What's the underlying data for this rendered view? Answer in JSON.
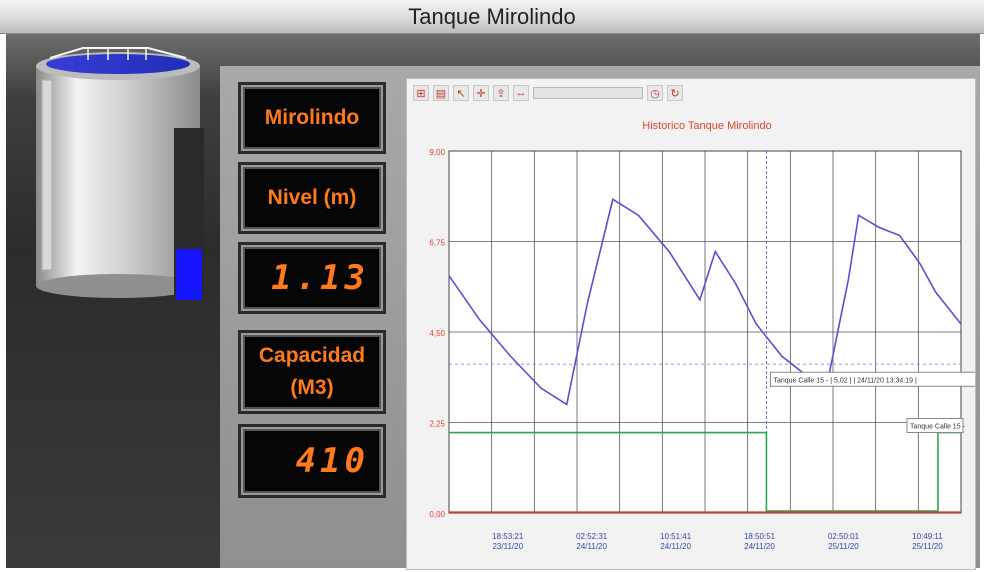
{
  "window": {
    "title": "Tanque Mirolindo"
  },
  "tank": {
    "fill_fraction": 0.38
  },
  "displays": {
    "name_label": "Mirolindo",
    "level_label": "Nivel (m)",
    "level_value": "1.13",
    "capacity_label_1": "Capacidad",
    "capacity_label_2": "(M3)",
    "capacity_value": "410"
  },
  "toolbar": {
    "buttons": [
      "zoom",
      "print",
      "cursor",
      "crosshair",
      "export",
      "range",
      "history",
      "refresh"
    ]
  },
  "chart_data": {
    "type": "line",
    "title": "Historico Tanque Mirolindo",
    "ylim": [
      0,
      9
    ],
    "yticks": [
      "9,00",
      "6,75",
      "4,50",
      "2,25",
      "0,00"
    ],
    "xticks": [
      {
        "time": "18:53:21",
        "date": "23/11/20"
      },
      {
        "time": "02:52:31",
        "date": "24/11/20"
      },
      {
        "time": "10:51:41",
        "date": "24/11/20"
      },
      {
        "time": "18:50:51",
        "date": "24/11/20"
      },
      {
        "time": "02:50:01",
        "date": "25/11/20"
      },
      {
        "time": "10:49:11",
        "date": "25/11/20"
      }
    ],
    "xlim": [
      0,
      100
    ],
    "series": [
      {
        "color": "#5b4fd1",
        "x": [
          0,
          6,
          12,
          18,
          23,
          27,
          32,
          37,
          43,
          49,
          52,
          56,
          60,
          65,
          70,
          74,
          78,
          80,
          84,
          88,
          92,
          95,
          100
        ],
        "y": [
          5.9,
          4.8,
          3.9,
          3.1,
          2.7,
          5.2,
          7.8,
          7.4,
          6.5,
          5.3,
          6.5,
          5.7,
          4.7,
          3.9,
          3.4,
          3.3,
          5.8,
          7.4,
          7.1,
          6.9,
          6.2,
          5.5,
          4.7
        ]
      },
      {
        "color": "#2fa84a",
        "x": [
          0,
          62,
          62,
          95.5,
          95.5,
          100
        ],
        "y": [
          2.0,
          2.0,
          0.05,
          0.05,
          2.0,
          2.0
        ]
      },
      {
        "color": "#d23b2c",
        "x": [
          0,
          100
        ],
        "y": [
          0.02,
          0.02
        ]
      }
    ],
    "cursor_x": 62,
    "tooltip_1": "Tanque Calle 15 - | 5,02 | | 24/11/20 13:34:19 |",
    "tooltip_2": "Tanque Calle 15 -",
    "guide_y": 3.7
  }
}
